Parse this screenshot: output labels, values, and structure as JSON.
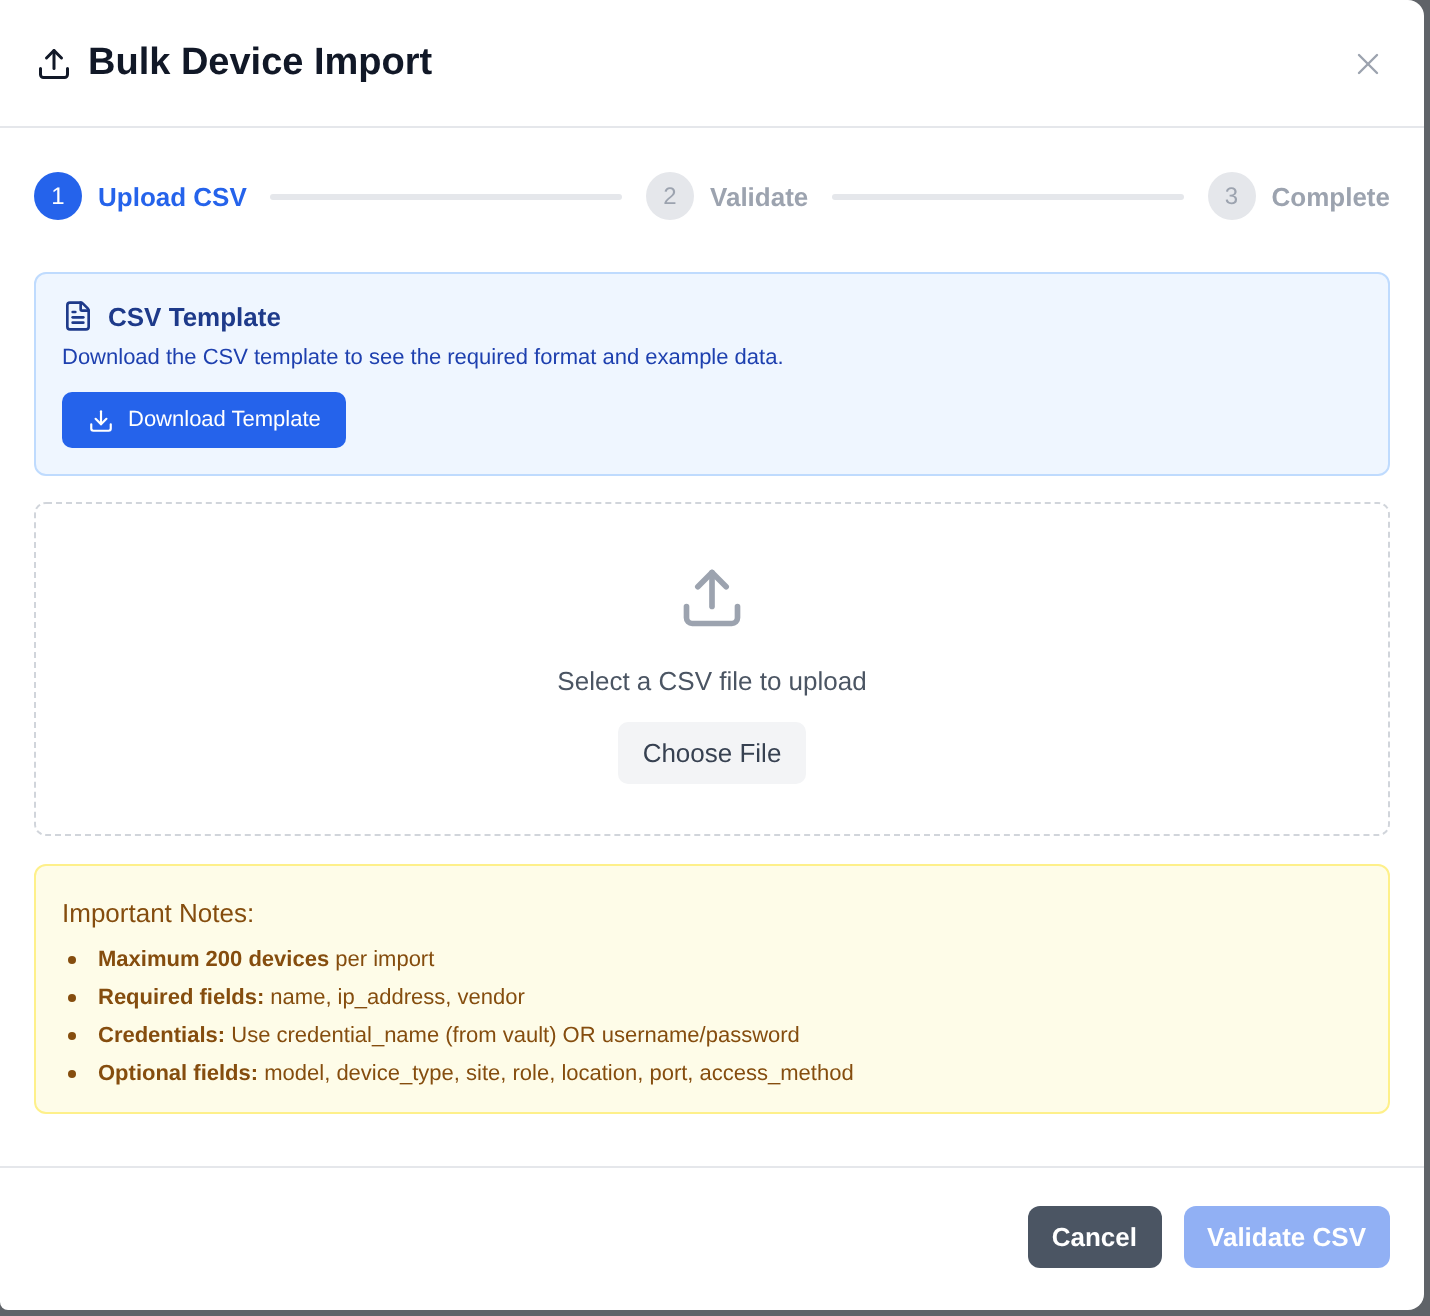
{
  "dialog": {
    "title": "Bulk Device Import"
  },
  "steps": [
    {
      "number": "1",
      "label": "Upload CSV",
      "active": true
    },
    {
      "number": "2",
      "label": "Validate",
      "active": false
    },
    {
      "number": "3",
      "label": "Complete",
      "active": false
    }
  ],
  "template_card": {
    "title": "CSV Template",
    "description": "Download the CSV template to see the required format and example data.",
    "button": "Download Template"
  },
  "upload_area": {
    "prompt": "Select a CSV file to upload",
    "button": "Choose File"
  },
  "notes": {
    "title": "Important Notes:",
    "items": [
      "**Maximum 200 devices** per import",
      "**Required fields:** name, ip_address, vendor",
      "**Credentials:** Use credential_name (from vault) OR username/password",
      "**Optional fields:** model, device_type, site, role, location, port, access_method"
    ]
  },
  "footer": {
    "buttons": [
      {
        "label": "Cancel",
        "kind": "secondary",
        "disabled": false
      },
      {
        "label": "Validate CSV",
        "kind": "primary",
        "disabled": true
      }
    ]
  }
}
